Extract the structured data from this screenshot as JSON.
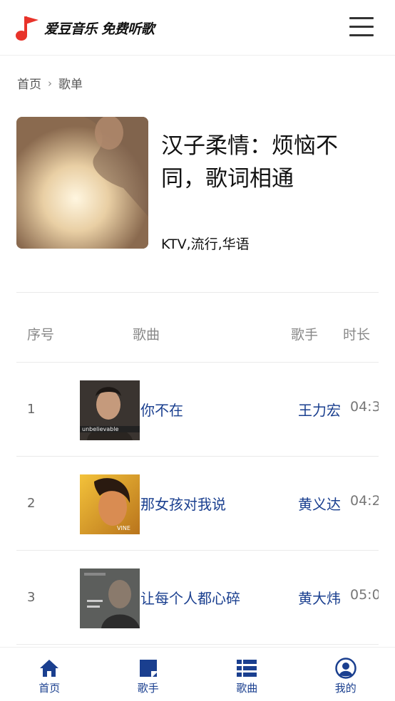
{
  "header": {
    "app_name": "爱豆音乐 免费听歌",
    "icons": {
      "logo": "music-note-logo",
      "menu": "hamburger-menu-icon"
    }
  },
  "breadcrumb": {
    "home": "首页",
    "current": "歌单"
  },
  "playlist": {
    "title": "汉子柔情：烦恼不同，歌词相通",
    "tags": "KTV,流行,华语"
  },
  "table": {
    "headers": {
      "index": "序号",
      "song": "歌曲",
      "artist": "歌手",
      "duration": "时长"
    },
    "rows": [
      {
        "index": "1",
        "song": "你不在",
        "artist": "王力宏",
        "duration": "04:3"
      },
      {
        "index": "2",
        "song": "那女孩对我说",
        "artist": "黄义达",
        "duration": "04:2"
      },
      {
        "index": "3",
        "song": "让每个人都心碎",
        "artist": "黄大炜",
        "duration": "05:0"
      }
    ]
  },
  "tabbar": {
    "items": [
      {
        "label": "首页",
        "icon": "home-icon"
      },
      {
        "label": "歌手",
        "icon": "singer-icon"
      },
      {
        "label": "歌曲",
        "icon": "song-list-icon"
      },
      {
        "label": "我的",
        "icon": "user-icon"
      }
    ]
  },
  "colors": {
    "accent": "#1a3f8f",
    "logo_red": "#e8332a"
  }
}
